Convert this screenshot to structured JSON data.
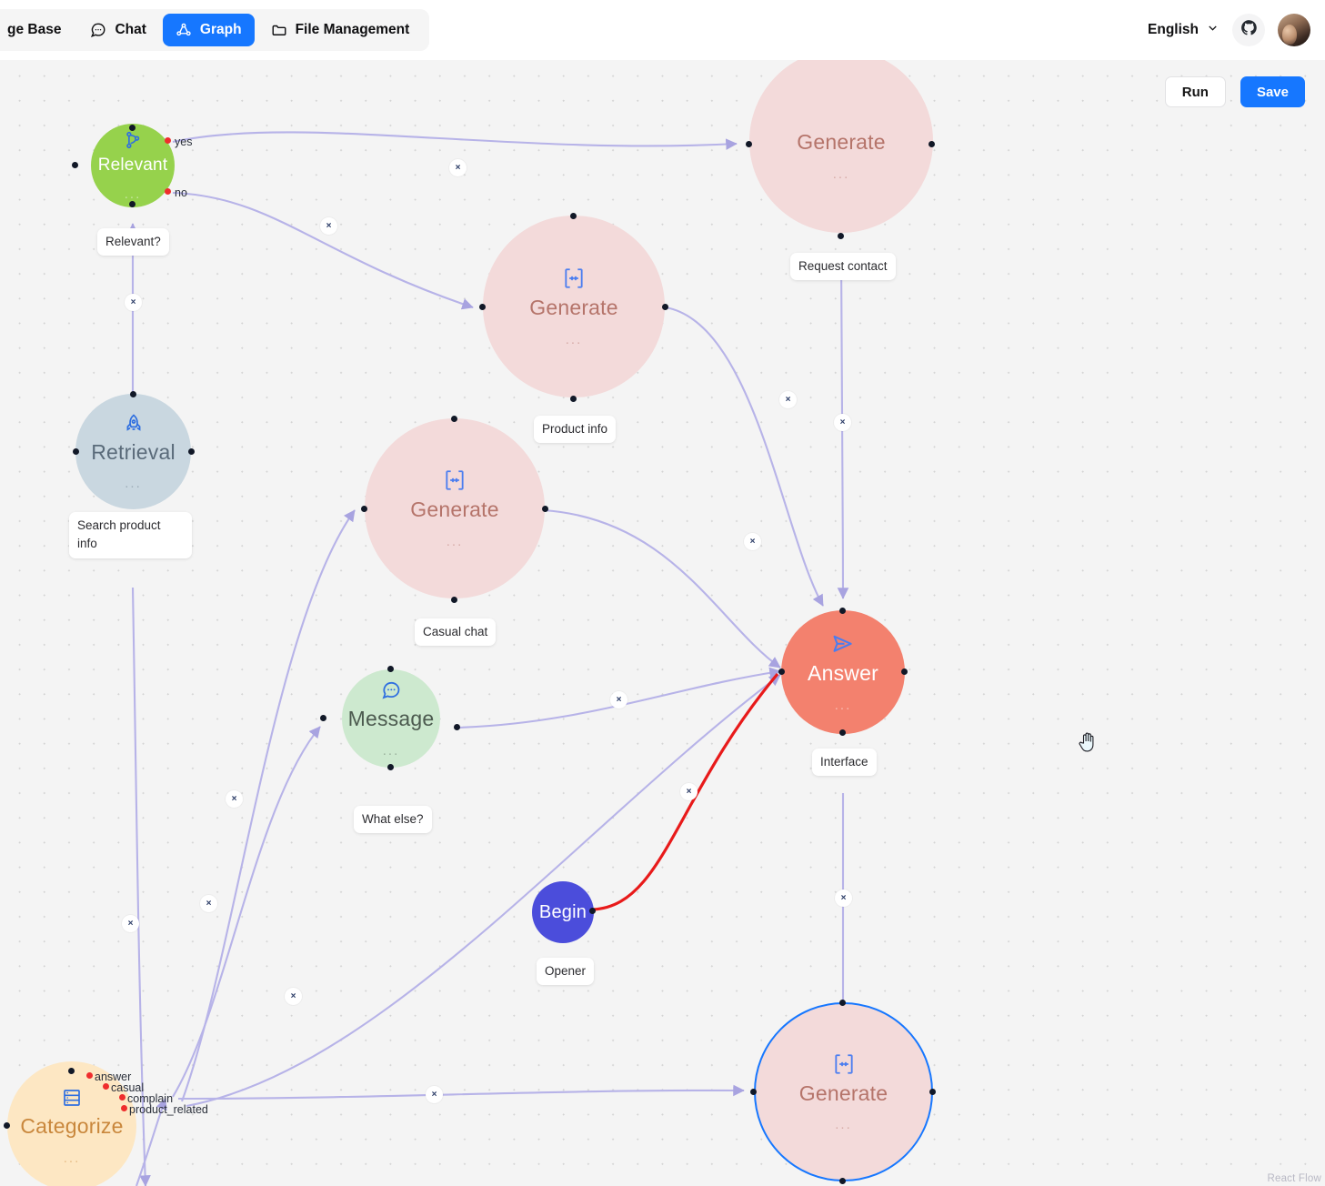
{
  "header": {
    "nav": [
      {
        "label": "ge Base",
        "icon": "",
        "active": false
      },
      {
        "label": "Chat",
        "icon": "chat-icon",
        "active": false
      },
      {
        "label": "Graph",
        "icon": "graph-icon",
        "active": true
      },
      {
        "label": "File Management",
        "icon": "folder-icon",
        "active": false
      }
    ],
    "language": "English",
    "language_caret": "chevron-down-icon",
    "github": "github-icon",
    "avatar": "user-avatar"
  },
  "toolbar": {
    "run_label": "Run",
    "save_label": "Save"
  },
  "canvas": {
    "watermark": "React Flow",
    "cursor": "grab-hand-cursor",
    "background_color": "#f4f4f4",
    "dot_color": "#d4d4d4",
    "edge_color": "#b7b3e8",
    "edge_highlight_color": "#e81a1a"
  },
  "nodes": [
    {
      "id": "relevant",
      "label": "Relevant",
      "chip": "Relevant?",
      "icon": "branch-icon",
      "color": "#96d24c",
      "dots": "...",
      "outputs": [
        "yes",
        "no"
      ]
    },
    {
      "id": "generate-request-contact",
      "label": "Generate",
      "chip": "Request contact",
      "icon": "generate-icon",
      "color": "#f3dada",
      "dots": "..."
    },
    {
      "id": "generate-product-info",
      "label": "Generate",
      "chip": "Product info",
      "icon": "generate-icon",
      "color": "#f3dada",
      "dots": "..."
    },
    {
      "id": "retrieval",
      "label": "Retrieval",
      "chip": "Search product info",
      "icon": "rocket-icon",
      "color": "#c9d7e0",
      "dots": "..."
    },
    {
      "id": "generate-casual-chat",
      "label": "Generate",
      "chip": "Casual chat",
      "icon": "generate-icon",
      "color": "#f3dada",
      "dots": "..."
    },
    {
      "id": "answer",
      "label": "Answer",
      "chip": "Interface",
      "icon": "send-icon",
      "color": "#f3816e",
      "dots": "..."
    },
    {
      "id": "message",
      "label": "Message",
      "chip": "What else?",
      "icon": "message-bubble-icon",
      "color": "#cde9cf",
      "dots": "..."
    },
    {
      "id": "begin",
      "label": "Begin",
      "chip": "Opener",
      "icon": "",
      "color": "#4b4ddb"
    },
    {
      "id": "generate-selected",
      "label": "Generate",
      "chip": "",
      "icon": "generate-icon",
      "color": "#f3dada",
      "dots": "...",
      "selected": true
    },
    {
      "id": "categorize",
      "label": "Categorize",
      "chip": "",
      "icon": "categorize-icon",
      "color": "#fde7c3",
      "dots": "...",
      "outputs": [
        "answer",
        "casual",
        "complain",
        "product_related"
      ]
    }
  ],
  "edge_buttons": [
    {
      "label": "×"
    },
    {
      "label": "×"
    },
    {
      "label": "×"
    },
    {
      "label": "×"
    },
    {
      "label": "×"
    },
    {
      "label": "×"
    },
    {
      "label": "×"
    },
    {
      "label": "×"
    },
    {
      "label": "×"
    },
    {
      "label": "×"
    },
    {
      "label": "×"
    },
    {
      "label": "×"
    },
    {
      "label": "×"
    },
    {
      "label": "×"
    }
  ]
}
